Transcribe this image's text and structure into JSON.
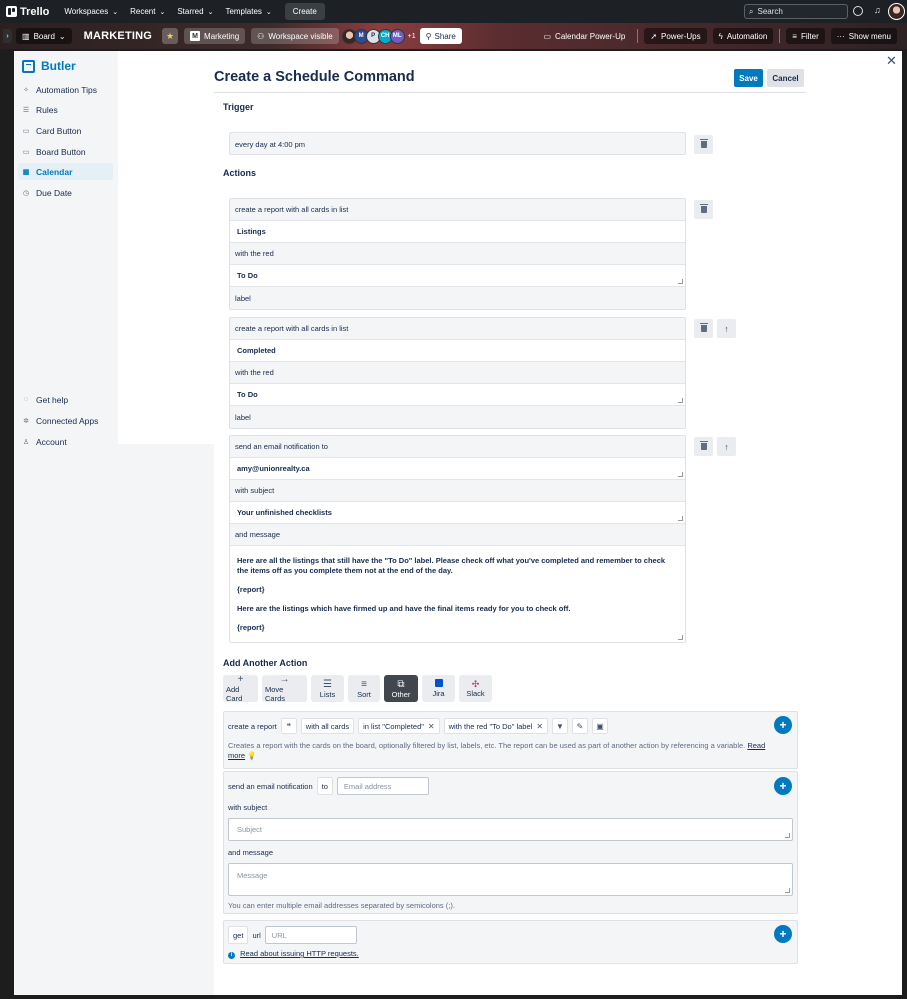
{
  "topnav": {
    "brand": "Trello",
    "menus": [
      "Workspaces",
      "Recent",
      "Starred",
      "Templates"
    ],
    "create_label": "Create",
    "search_placeholder": "Search"
  },
  "boardbar": {
    "view_label": "Board",
    "board_title": "MARKETING",
    "workspace_label": "Marketing",
    "workspace_badge": "M",
    "visibility_label": "Workspace visible",
    "members": [
      {
        "initials": "",
        "color": "#d9c3b8"
      },
      {
        "initials": "M",
        "color": "#2d4b8e"
      },
      {
        "initials": "P",
        "color": "#dfe1e6"
      },
      {
        "initials": "CH",
        "color": "#00aecc"
      },
      {
        "initials": "ML",
        "color": "#6e5dc6"
      }
    ],
    "more_members": "+1",
    "share_label": "Share",
    "calendar_powerup_label": "Calendar Power-Up",
    "powerups_label": "Power-Ups",
    "automation_label": "Automation",
    "filter_label": "Filter",
    "show_menu_label": "Show menu"
  },
  "sidebar": {
    "title": "Butler",
    "items": [
      {
        "label": "Automation Tips",
        "icon": "sparkle-icon"
      },
      {
        "label": "Rules",
        "icon": "rules-icon"
      },
      {
        "label": "Card Button",
        "icon": "card-icon"
      },
      {
        "label": "Board Button",
        "icon": "board-icon"
      },
      {
        "label": "Calendar",
        "icon": "calendar-icon"
      },
      {
        "label": "Due Date",
        "icon": "clock-icon"
      }
    ],
    "bottom_items": [
      {
        "label": "Get help",
        "icon": "help-icon"
      },
      {
        "label": "Connected Apps",
        "icon": "apps-icon"
      },
      {
        "label": "Account",
        "icon": "account-icon"
      }
    ]
  },
  "main": {
    "title": "Create a Schedule Command",
    "save_label": "Save",
    "cancel_label": "Cancel",
    "trigger_heading": "Trigger",
    "trigger_text": "every day at 4:00 pm",
    "actions_heading": "Actions",
    "action1": {
      "line1": "create a report with all cards in list",
      "list_value": "Listings",
      "line2": "with the red",
      "label_value": "To Do",
      "line3": "label"
    },
    "action2": {
      "line1": "create a report with all cards in list",
      "list_value": "Completed",
      "line2": "with the red",
      "label_value": "To Do",
      "line3": "label"
    },
    "action3": {
      "line1": "send an email notification to",
      "email_value": "amy@unionrealty.ca",
      "line2": "with subject",
      "subject_value": "Your unfinished checklists",
      "line3": "and message",
      "message_p1": "Here are all the listings that still have the \"To Do\" label. Please check off what you've completed and remember to check the items off as you complete them not at the end of the day.",
      "message_p2": "{report}",
      "message_p3": "Here are the listings which have firmed up and have the final items ready for you to check off.",
      "message_p4": "{report}"
    }
  },
  "add_action": {
    "heading": "Add Another Action",
    "tabs": [
      {
        "label": "Add Card",
        "icon": "plus-icon"
      },
      {
        "label": "Move Cards",
        "icon": "arrow-right-icon"
      },
      {
        "label": "Lists",
        "icon": "list-icon"
      },
      {
        "label": "Sort",
        "icon": "sort-icon"
      },
      {
        "label": "Other",
        "icon": "copy-icon"
      },
      {
        "label": "Jira",
        "icon": "jira-icon"
      },
      {
        "label": "Slack",
        "icon": "slack-icon"
      }
    ],
    "active_tab": "Other",
    "report": {
      "prefix": "create a report",
      "with_cards": "with all cards",
      "in_list": "in list \"Completed\"",
      "with_label": "with the red \"To Do\" label",
      "description": "Creates a report with the cards on the board, optionally filtered by list, labels, etc. The report can be used as part of another action by referencing a variable.",
      "read_more": "Read more"
    },
    "email": {
      "prefix": "send an email notification",
      "to_label": "to",
      "email_placeholder": "Email address",
      "subject_label": "with subject",
      "subject_placeholder": "Subject",
      "message_label": "and message",
      "message_placeholder": "Message",
      "hint": "You can enter multiple email addresses separated by semicolons (;)."
    },
    "http": {
      "method": "get",
      "url_label": "url",
      "url_placeholder": "URL",
      "help_link": "Read about issuing HTTP requests."
    }
  }
}
